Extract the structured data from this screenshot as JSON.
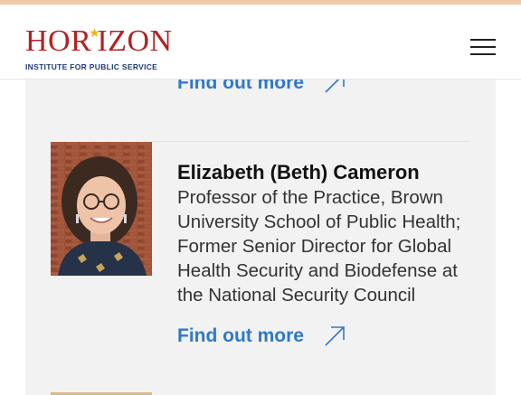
{
  "header": {
    "logo_main": "HORIZON",
    "logo_sub": "INSTITUTE FOR PUBLIC SERVICE"
  },
  "previous_card": {
    "link_label": "Find out more"
  },
  "card": {
    "name": "Elizabeth (Beth) Cameron",
    "description": "Professor of the Practice, Brown University School of Public Health; Former Senior Director for Global Health Security and Biodefense at the National Security Council",
    "link_label": "Find out more"
  },
  "colors": {
    "accent_link": "#2f79c8",
    "logo_red": "#b32121",
    "logo_blue": "#1e3a7a",
    "card_bg": "#f2f2f2"
  },
  "icons": [
    "menu-icon",
    "arrow-up-right-icon"
  ]
}
